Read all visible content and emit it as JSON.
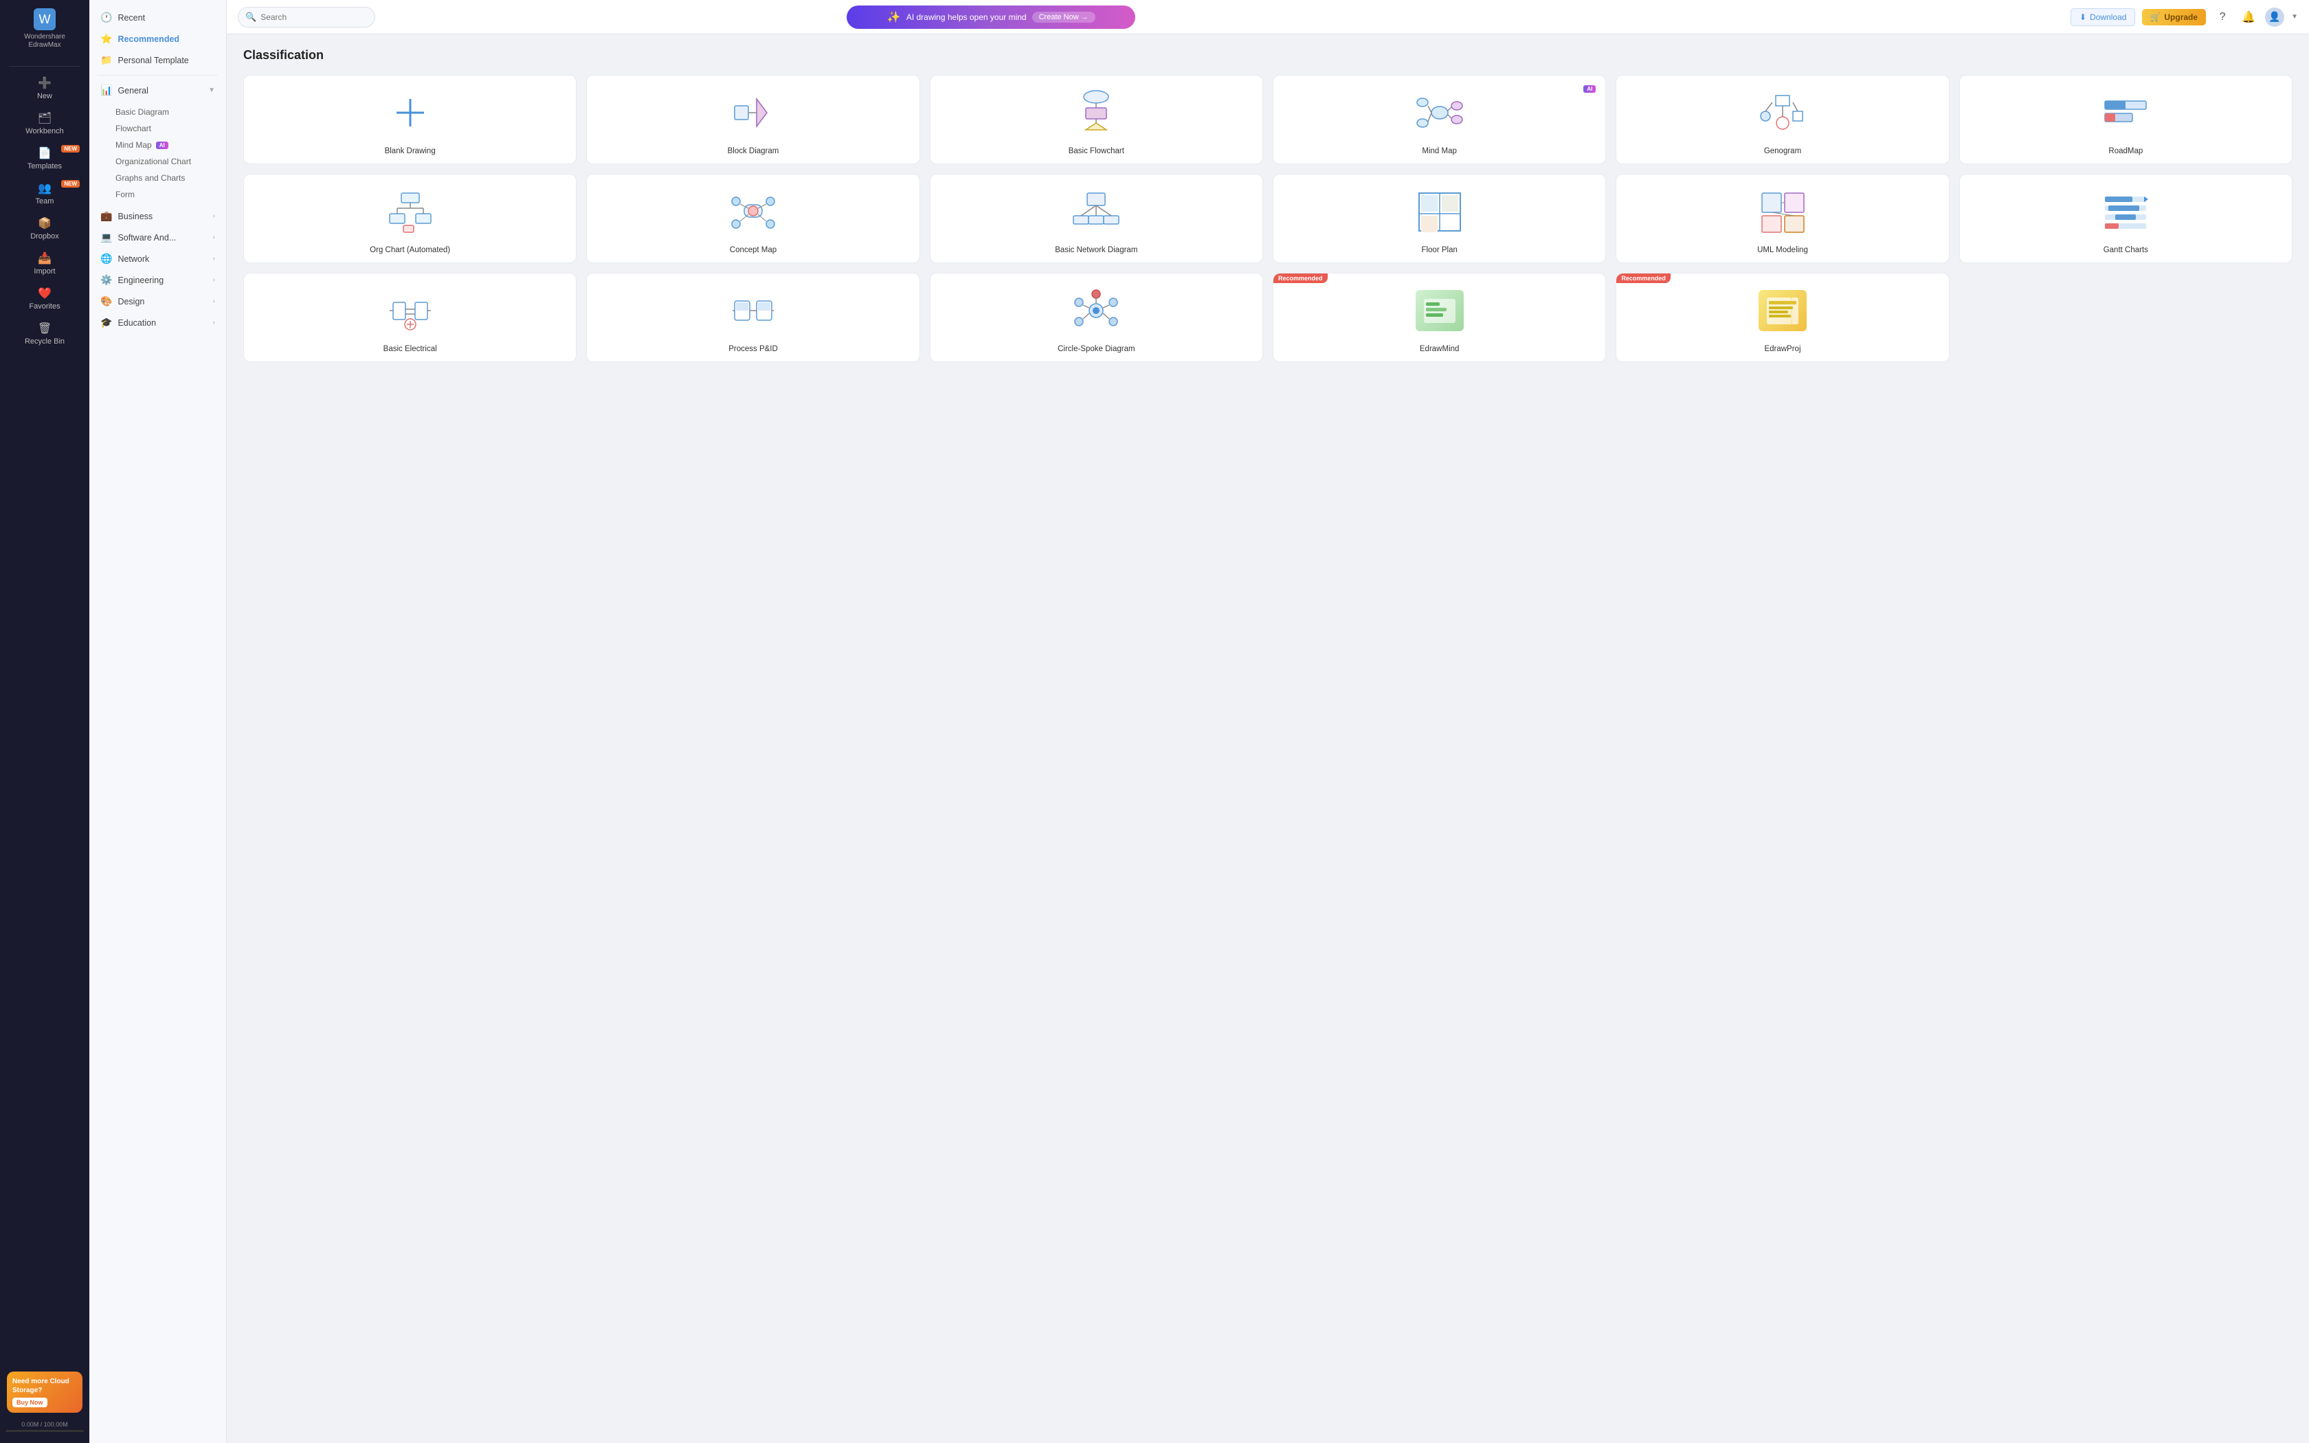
{
  "app": {
    "name": "Wondershare",
    "name2": "EdrawMax"
  },
  "header": {
    "search_placeholder": "Search",
    "ai_banner_text": "AI drawing helps open your mind",
    "ai_banner_btn": "Create Now →",
    "download_label": "Download",
    "upgrade_label": "Upgrade",
    "storage_used": "0.00M",
    "storage_total": "100.00M"
  },
  "left_nav": {
    "items": [
      {
        "id": "new",
        "label": "New",
        "icon": "➕"
      },
      {
        "id": "workbench",
        "label": "Workbench",
        "icon": "🗂"
      },
      {
        "id": "templates",
        "label": "Templates",
        "icon": "📄",
        "badge": "NEW"
      },
      {
        "id": "team",
        "label": "Team",
        "icon": "👥",
        "badge": "NEW"
      },
      {
        "id": "dropbox",
        "label": "Dropbox",
        "icon": "📦"
      },
      {
        "id": "import",
        "label": "Import",
        "icon": "📥"
      },
      {
        "id": "favorites",
        "label": "Favorites",
        "icon": "❤️"
      },
      {
        "id": "recycle",
        "label": "Recycle Bin",
        "icon": "🗑"
      }
    ],
    "cloud_promo": {
      "title": "Need more Cloud Storage?",
      "btn": "Buy Now"
    },
    "storage_label": "0.00M / 100.00M"
  },
  "panel_sidebar": {
    "items": [
      {
        "id": "recent",
        "label": "Recent",
        "icon": "🕐"
      },
      {
        "id": "recommended",
        "label": "Recommended",
        "icon": "⭐",
        "active": true
      },
      {
        "id": "personal",
        "label": "Personal Template",
        "icon": "📁"
      }
    ],
    "sections": [
      {
        "id": "general",
        "label": "General",
        "icon": "📊",
        "expanded": true,
        "sub_items": [
          {
            "id": "basic-diagram",
            "label": "Basic Diagram"
          },
          {
            "id": "flowchart",
            "label": "Flowchart"
          },
          {
            "id": "mind-map",
            "label": "Mind Map",
            "ai": true
          },
          {
            "id": "org-chart",
            "label": "Organizational Chart"
          },
          {
            "id": "graphs",
            "label": "Graphs and Charts"
          },
          {
            "id": "form",
            "label": "Form"
          }
        ]
      },
      {
        "id": "business",
        "label": "Business",
        "icon": "💼",
        "has_arrow": true
      },
      {
        "id": "software",
        "label": "Software And...",
        "icon": "💻",
        "has_arrow": true
      },
      {
        "id": "network",
        "label": "Network",
        "icon": "🌐",
        "has_arrow": true
      },
      {
        "id": "engineering",
        "label": "Engineering",
        "icon": "⚙️",
        "has_arrow": true
      },
      {
        "id": "design",
        "label": "Design",
        "icon": "🎨",
        "has_arrow": true
      },
      {
        "id": "education",
        "label": "Education",
        "icon": "🎓",
        "has_arrow": true
      }
    ]
  },
  "main": {
    "section_title": "Classification",
    "cards": [
      {
        "id": "blank",
        "label": "Blank Drawing",
        "type": "blank"
      },
      {
        "id": "block",
        "label": "Block Diagram",
        "type": "block"
      },
      {
        "id": "flowchart",
        "label": "Basic Flowchart",
        "type": "flowchart"
      },
      {
        "id": "mindmap",
        "label": "Mind Map",
        "type": "mindmap",
        "ai": true
      },
      {
        "id": "genogram",
        "label": "Genogram",
        "type": "genogram"
      },
      {
        "id": "roadmap",
        "label": "RoadMap",
        "type": "roadmap"
      },
      {
        "id": "org",
        "label": "Org Chart (Automated)",
        "type": "org"
      },
      {
        "id": "concept",
        "label": "Concept Map",
        "type": "concept"
      },
      {
        "id": "network",
        "label": "Basic Network Diagram",
        "type": "network"
      },
      {
        "id": "floorplan",
        "label": "Floor Plan",
        "type": "floorplan"
      },
      {
        "id": "uml",
        "label": "UML Modeling",
        "type": "uml"
      },
      {
        "id": "gantt",
        "label": "Gantt Charts",
        "type": "gantt"
      },
      {
        "id": "electrical",
        "label": "Basic Electrical",
        "type": "electrical"
      },
      {
        "id": "pid",
        "label": "Process P&ID",
        "type": "pid"
      },
      {
        "id": "circle",
        "label": "Circle-Spoke Diagram",
        "type": "circle"
      },
      {
        "id": "edrawmind",
        "label": "EdrawMind",
        "type": "edrawmind",
        "recommended": true
      },
      {
        "id": "edrawproj",
        "label": "EdrawProj",
        "type": "edrawproj",
        "recommended": true
      }
    ]
  }
}
